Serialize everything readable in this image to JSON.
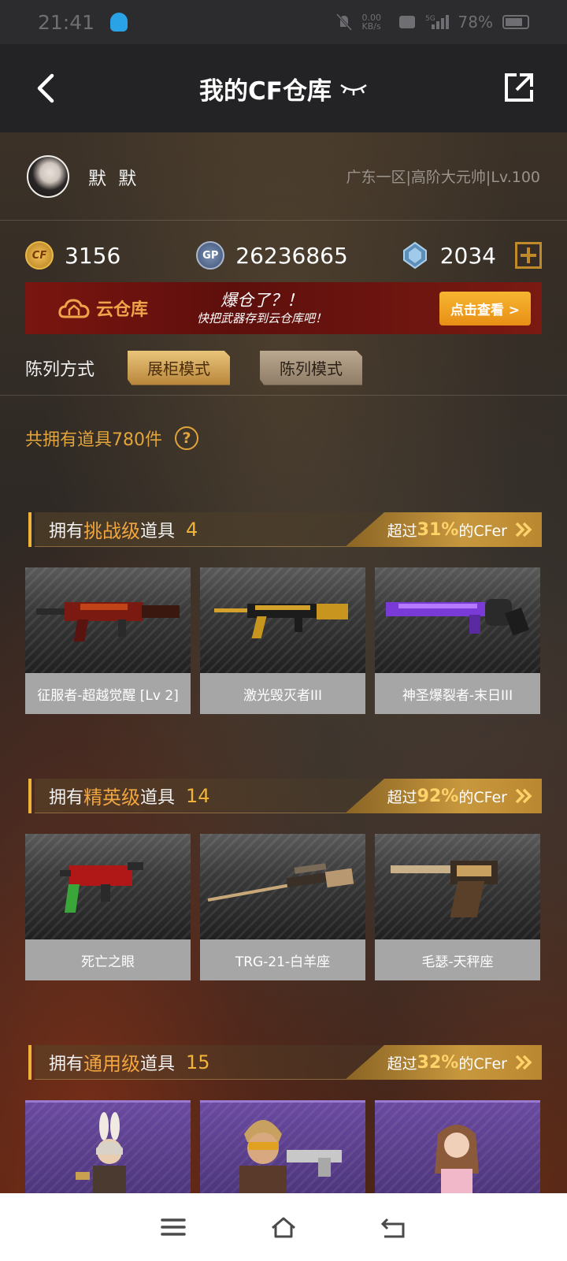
{
  "status_bar": {
    "time": "21:41",
    "net_speed": "0.00 KB/s",
    "battery": "78%"
  },
  "header": {
    "title": "我的CF仓库"
  },
  "profile": {
    "name": "默 默",
    "region": "广东一区|高阶大元帅|Lv.100"
  },
  "currency": {
    "cf_points": "3156",
    "gp": "26236865",
    "diamonds": "2034",
    "cf_icon_text": "CF",
    "gp_icon_text": "GP"
  },
  "banner": {
    "label": "云仓库",
    "line1": "爆仓了？！",
    "line2": "快把武器存到云仓库吧！",
    "cta": "点击查看 >"
  },
  "display_mode": {
    "label": "陈列方式",
    "options": [
      "展柜模式",
      "陈列模式"
    ],
    "active": "展柜模式"
  },
  "total_items": "共拥有道具780件",
  "help_glyph": "?",
  "sections": [
    {
      "prefix": "拥有",
      "tier": "挑战级",
      "suffix": "道具",
      "count": "4",
      "over_label": "超过",
      "percent": "31%",
      "fans": "的CFer",
      "items": [
        "征服者-超越觉醒 [Lv 2]",
        "激光毁灭者III",
        "神圣爆裂者-末日III"
      ]
    },
    {
      "prefix": "拥有",
      "tier": "精英级",
      "suffix": "道具",
      "count": "14",
      "over_label": "超过",
      "percent": "92%",
      "fans": "的CFer",
      "items": [
        "死亡之眼",
        "TRG-21-白羊座",
        "毛瑟-天秤座"
      ]
    },
    {
      "prefix": "拥有",
      "tier": "通用级",
      "suffix": "道具",
      "count": "15",
      "over_label": "超过",
      "percent": "32%",
      "fans": "的CFer",
      "items": []
    }
  ],
  "colors": {
    "accent": "#f0b33a",
    "tier_text": "#f0a540",
    "header_bg": "#232326",
    "banner_bg": "#7a1510"
  }
}
